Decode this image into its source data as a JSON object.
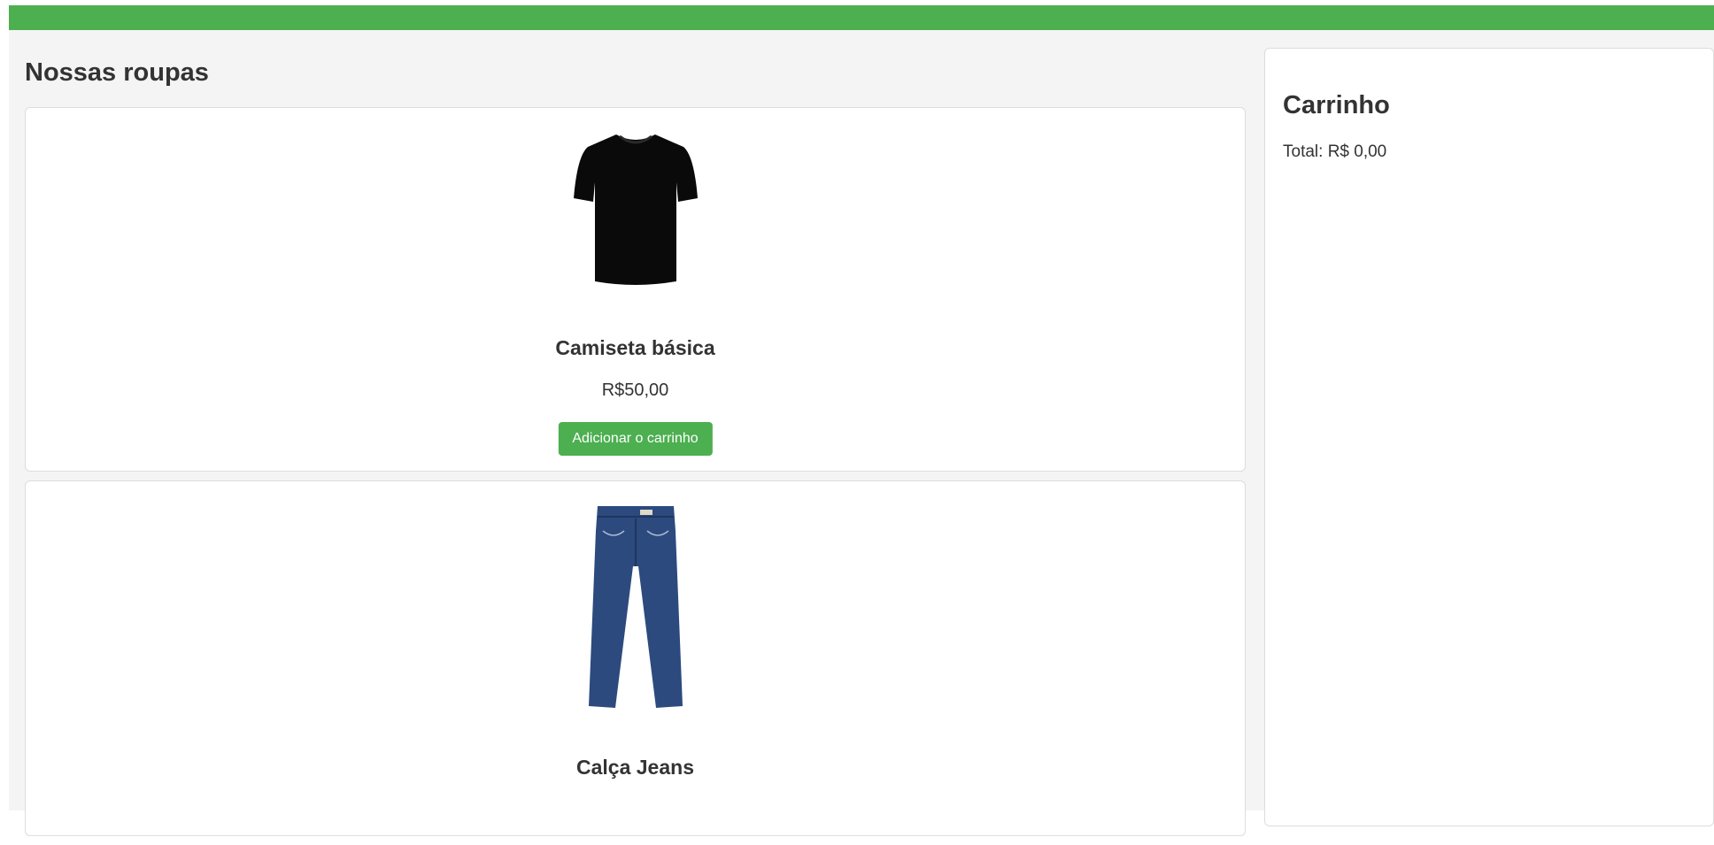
{
  "products_section": {
    "title": "Nossas roupas",
    "items": [
      {
        "name": "Camiseta básica",
        "price": "R$50,00",
        "button_label": "Adicionar o carrinho",
        "image": "black-tshirt"
      },
      {
        "name": "Calça Jeans",
        "image": "blue-jeans"
      }
    ]
  },
  "cart": {
    "title": "Carrinho",
    "total": "Total: R$ 0,00"
  },
  "colors": {
    "accent": "#4caf50",
    "background": "#f4f4f4",
    "card": "#ffffff",
    "text": "#333333"
  }
}
